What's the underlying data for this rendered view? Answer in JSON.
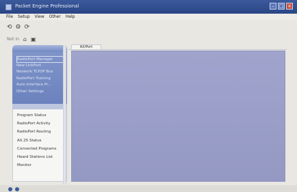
{
  "window": {
    "title": "Packet Engine Professional",
    "accent_color": "#2a4585",
    "buttons": [
      "minimize",
      "maximize",
      "close"
    ]
  },
  "menubar": {
    "items": [
      "File",
      "Setup",
      "View",
      "Other",
      "Help"
    ]
  },
  "toolbar": {
    "icons": [
      "back-icon",
      "gear-icon",
      "refresh-icon"
    ]
  },
  "addressbar": {
    "label": "Not in",
    "icons": [
      "home-icon",
      "save-icon"
    ]
  },
  "sidebar": {
    "panel1_items": [
      "RadioPort Manager",
      "New LinkPort",
      "Network TCP/IP Bus",
      "RadioPort Training",
      "Auto Interface Pr...",
      "Other Settings"
    ],
    "panel2_items": [
      "Program Status",
      "RadioPort Activity",
      "RadioPort Routing",
      "AX.25 Status",
      "Connected Programs",
      "Heard Stations List",
      "Monitor"
    ]
  },
  "content": {
    "active_tab": "AX/Port",
    "background_color": "#9a9ec9"
  },
  "statusbar": {
    "icons": [
      "status-icon",
      "connection-icon"
    ]
  }
}
